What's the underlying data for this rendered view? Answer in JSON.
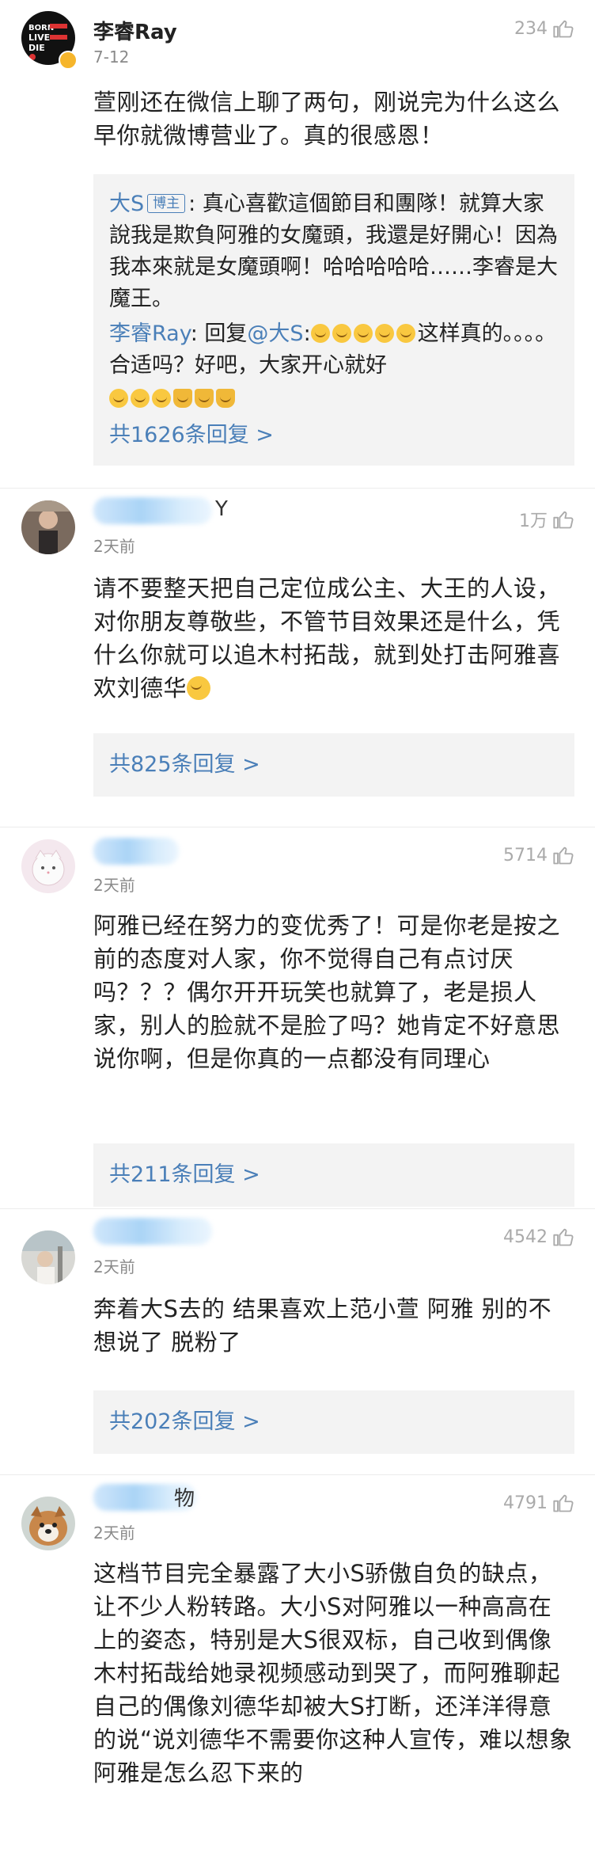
{
  "comments": [
    {
      "username": "李睿Ray",
      "date": "7-12",
      "likes": "234",
      "text": "萱刚还在微信上聊了两句，刚说完为什么这么早你就微博营业了。真的很感恩！",
      "replies": [
        {
          "user": "大S",
          "badge": "博主",
          "text": ": 真心喜歡這個節目和團隊！就算大家說我是欺負阿雅的女魔頭，我還是好開心！因為我本來就是女魔頭啊！哈哈哈哈哈……李睿是大魔王。"
        },
        {
          "user": "李睿Ray",
          "prefix": ": 回复",
          "mention": "@大S",
          "text_a": ":",
          "text_b": "这样真的。。。。合适吗？好吧，大家开心就好"
        }
      ],
      "more_replies": "共1626条回复 >",
      "avatar_lines": [
        "BORN",
        "LIVE",
        "DIE"
      ]
    },
    {
      "name_suffix": "Y",
      "date": "2天前",
      "likes": "1万",
      "text": "请不要整天把自己定位成公主、大王的人设，对你朋友尊敬些，不管节目效果还是什么，凭什么你就可以追木村拓哉，就到处打击阿雅喜欢刘德华",
      "more_replies": "共825条回复 >"
    },
    {
      "date": "2天前",
      "likes": "5714",
      "text": "阿雅已经在努力的变优秀了！可是你老是按之前的态度对人家，你不觉得自己有点讨厌吗？？？偶尔开开玩笑也就算了，老是损人家，别人的脸就不是脸了吗？她肯定不好意思说你啊，但是你真的一点都没有同理心",
      "more_replies": "共211条回复 >"
    },
    {
      "date": "2天前",
      "likes": "4542",
      "text": "奔着大S去的 结果喜欢上范小萱 阿雅 别的不想说了 脱粉了",
      "more_replies": "共202条回复 >"
    },
    {
      "name_suffix": "物",
      "date": "2天前",
      "likes": "4791",
      "text": "这档节目完全暴露了大小S骄傲自负的缺点，让不少人粉转路。大小S对阿雅以一种高高在上的姿态，特别是大S很双标，自己收到偶像木村拓哉给她录视频感动到哭了，而阿雅聊起自己的偶像刘德华却被大S打断，还洋洋得意的说“说刘德华不需要你这种人宣传，难以想象阿雅是怎么忍下来的"
    }
  ],
  "colors": {
    "link": "#4a7fb8",
    "reply_bg": "#f3f3f3",
    "meta": "#8a8a8a",
    "like": "#aaaaaa"
  },
  "icons": {
    "like": "thumbs-up-icon",
    "emoji": "grin-emoji-icon",
    "vip": "verified-badge-icon"
  }
}
